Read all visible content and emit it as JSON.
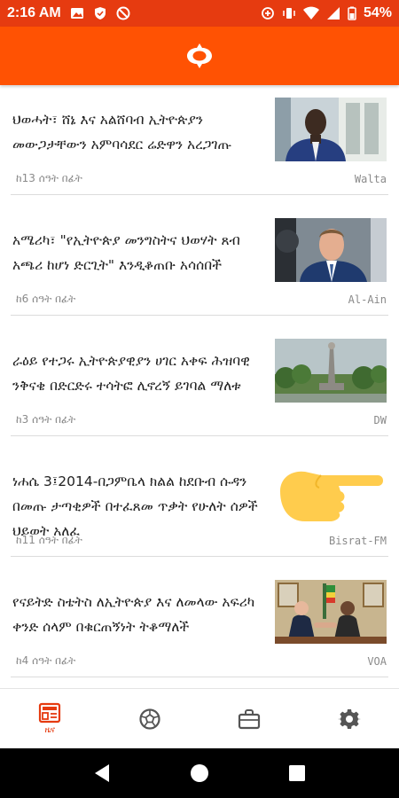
{
  "status_bar": {
    "time": "2:16 AM",
    "battery": "54%",
    "background": "#e63b10"
  },
  "app_bar": {
    "background": "#ff5203",
    "logo_icon": "app-logo-icon"
  },
  "news": [
    {
      "headline": "ህወሓት፣ ሸኔ እና አልሸባብ ኢትዮጵያን መውጋታቸውን አምባሳደር ሬድዋን አረጋገጡ",
      "time": "ከ13 ሰዓት በፊት",
      "source": "Walta",
      "thumb": "man-in-suit-image"
    },
    {
      "headline": "አሜሪካ፣ \"የኢትዮጵያ መንግስትና ህወሃት ጸብ አጫሪ ከሆነ ድርጊት\" እንዲቆጠቡ አሳሰበች",
      "time": "ከ6 ሰዓት በፊት",
      "source": "Al-Ain",
      "thumb": "man-speaking-image"
    },
    {
      "headline": "ራዕይ የተጋሩ ኢትዮጵያዊያን ሀገር አቀፍ ሕዝባዊ ንቅናቄ በድርድሩ ተሳትፎ ሊኖረኝ ይገባል ማለቱ",
      "time": "ከ3 ሰዓት በፊት",
      "source": "DW",
      "thumb": "monument-image"
    },
    {
      "headline": "ነሐሴ 3፤2014-በጋምቤላ ክልል ከደቡብ ሱዳን በመጡ ታጣቂዎች በተፈጸመ ጥቃት የሁለት ሰዎች ህይወት አለፈ",
      "time": "ከ11 ሰዓት በፊት",
      "source": "Bisrat-FM",
      "thumb": "pointing-hand-emoji"
    },
    {
      "headline": "የናይትድ ስቴትስ ለኢትዮጵያ እና ለመላው አፍሪካ ቀንድ ሰላም በቁርጠኝነት ትቆማለች",
      "time": "ከ4 ሰዓት በፊት",
      "source": "VOA",
      "thumb": "handshake-image"
    }
  ],
  "bottom_nav": {
    "items": [
      {
        "label": "ዜና",
        "icon": "news-icon",
        "active": true
      },
      {
        "label": "",
        "icon": "soccer-ball-icon",
        "active": false
      },
      {
        "label": "",
        "icon": "briefcase-icon",
        "active": false
      },
      {
        "label": "",
        "icon": "gear-icon",
        "active": false
      }
    ],
    "active_color": "#e63b10",
    "inactive_color": "#555555"
  }
}
